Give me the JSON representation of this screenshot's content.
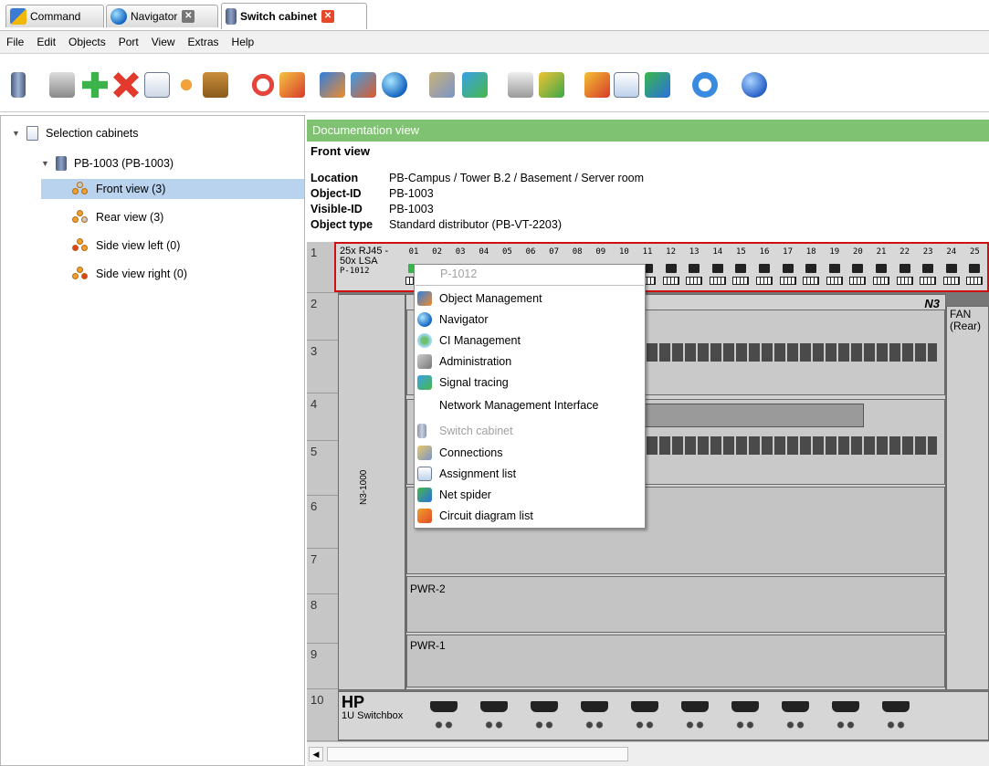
{
  "tabs": [
    {
      "label": "Command",
      "closable": false
    },
    {
      "label": "Navigator",
      "closable": true
    },
    {
      "label": "Switch cabinet",
      "closable": true,
      "active": true
    }
  ],
  "menu": [
    "File",
    "Edit",
    "Objects",
    "Port",
    "View",
    "Extras",
    "Help"
  ],
  "toolbar_icons": [
    "cabinet-icon",
    "print-icon",
    "add-icon",
    "delete-icon",
    "copy-icon",
    "cut-icon",
    "paste-icon",
    "lifebuoy-icon",
    "pencil-remove-icon",
    "layers-icon",
    "hierarchy-icon",
    "globe-icon",
    "connections-icon",
    "signal-tracing-icon",
    "view-icon",
    "spider-icon",
    "brush-icon",
    "report-icon",
    "cubes-icon",
    "refresh-icon",
    "help-icon"
  ],
  "tree": {
    "root": "Selection cabinets",
    "cabinet": "PB-1003 (PB-1003)",
    "views": [
      "Front view (3)",
      "Rear view (3)",
      "Side view left (0)",
      "Side view right (0)"
    ]
  },
  "doc": {
    "header": "Documentation view",
    "view_title": "Front view",
    "fields": [
      {
        "key": "Location",
        "value": "PB-Campus / Tower B.2 / Basement / Server room"
      },
      {
        "key": "Object-ID",
        "value": "PB-1003"
      },
      {
        "key": "Visible-ID",
        "value": "PB-1003"
      },
      {
        "key": "Object type",
        "value": "Standard distributor (PB-VT-2203)"
      }
    ]
  },
  "rack": {
    "units": [
      "1",
      "2",
      "3",
      "4",
      "5",
      "6",
      "7",
      "8",
      "9",
      "10"
    ],
    "patch_line1": "25x RJ45 -",
    "patch_line2": "50x LSA",
    "patch_id": "P-1012",
    "port_numbers": [
      "01",
      "02",
      "03",
      "04",
      "05",
      "06",
      "07",
      "08",
      "09",
      "10",
      "11",
      "12",
      "13",
      "14",
      "15",
      "16",
      "17",
      "18",
      "19",
      "20",
      "21",
      "22",
      "23",
      "24",
      "25"
    ],
    "switch_label": "N3-1000",
    "n3": "N3",
    "fan": "FAN",
    "fan_sub": "(Rear)",
    "pwr2": "PWR-2",
    "pwr1": "PWR-1",
    "hp_brand": "HP",
    "hp_model": "1U Switchbox"
  },
  "context_menu": {
    "title": "P-1012",
    "items": [
      {
        "label": "Object Management",
        "icon": "object-management-icon",
        "enabled": true
      },
      {
        "label": "Navigator",
        "icon": "globe-icon",
        "enabled": true
      },
      {
        "label": "CI Management",
        "icon": "ci-management-icon",
        "enabled": true
      },
      {
        "label": "Administration",
        "icon": "administration-icon",
        "enabled": true
      },
      {
        "label": "Signal tracing",
        "icon": "signal-tracing-icon",
        "enabled": true
      },
      {
        "label": "Network Management Interface",
        "icon": "",
        "enabled": true
      },
      {
        "label": "Switch cabinet",
        "icon": "cabinet-icon",
        "enabled": false
      },
      {
        "label": "Connections",
        "icon": "connections-icon",
        "enabled": true
      },
      {
        "label": "Assignment list",
        "icon": "assignment-list-icon",
        "enabled": true
      },
      {
        "label": "Net spider",
        "icon": "spider-icon",
        "enabled": true
      },
      {
        "label": "Circuit diagram list",
        "icon": "circuit-diagram-icon",
        "enabled": true
      }
    ]
  },
  "colors": {
    "doc_header": "#7fc271",
    "selection": "#b9d3ee",
    "close_active": "#e8482a",
    "rack_border": "#d01010"
  }
}
